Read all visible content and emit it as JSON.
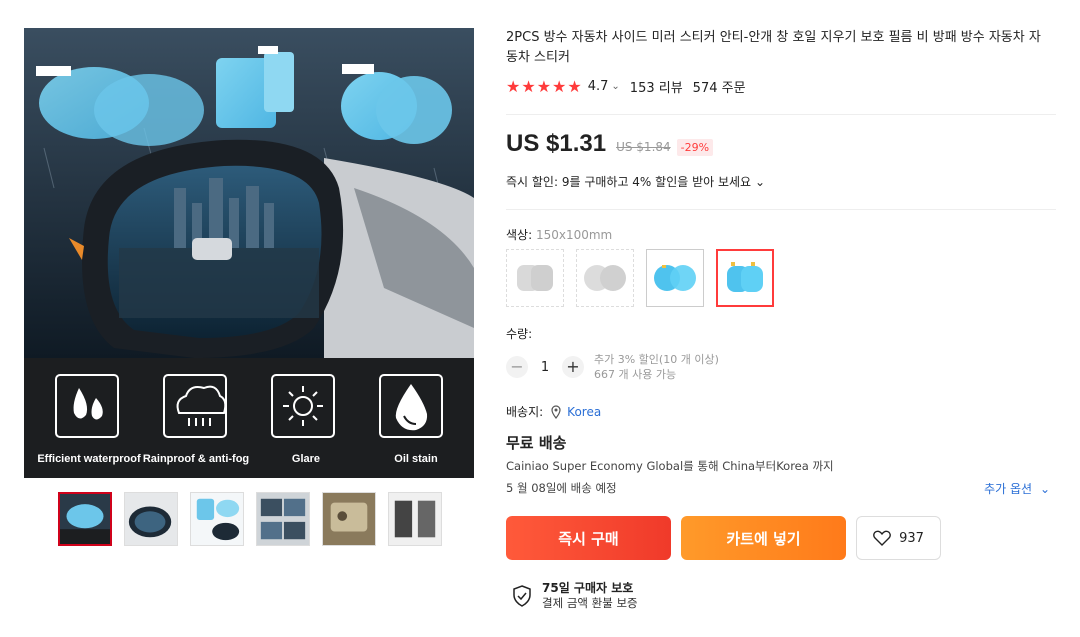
{
  "product": {
    "title": "2PCS 방수 자동차 사이드 미러 스티커 안티-안개 창 호일 지우기 보호 필름 비 방패 방수 자동차 자동차 스티커",
    "rating": "4.7",
    "reviews": "153 리뷰",
    "orders": "574 주문"
  },
  "gallery": {
    "main_image_captions": [
      "Efficient waterproof",
      "Rainproof & anti-fog",
      "Glare",
      "Oil stain"
    ],
    "thumbnail_count": 6,
    "active_thumbnail": 1
  },
  "price": {
    "current": "US $1.31",
    "original": "US $1.84",
    "discount": "-29%"
  },
  "promo": {
    "text": "즉시 할인: 9를 구매하고 4% 할인을 받아 보세요",
    "chevron": "⌄"
  },
  "variants": {
    "label": "색상:",
    "selected": "150x100mm"
  },
  "quantity": {
    "label": "수량:",
    "minus": "−",
    "value": "1",
    "plus": "+",
    "note1": "추가 3% 할인(10 개 이상)",
    "note2": "667 개 사용 가능"
  },
  "shipping": {
    "label": "배송지:",
    "location": "Korea",
    "free": "무료 배송",
    "desc": "Cainiao Super Economy Global를 통해 China부터Korea 까지",
    "eta": "5 월 08일에 배송 예정",
    "more": "추가 옵션"
  },
  "actions": {
    "buy": "즉시 구매",
    "cart": "카트에 넣기",
    "wish_count": "937"
  },
  "protection": {
    "title": "75일 구매자 보호",
    "sub": "결제 금액 환불 보증"
  },
  "colors": {
    "accent": "#ff3b3b",
    "buy": "#f04a2f",
    "cart": "#ff8c20",
    "link": "#2b6fd6"
  }
}
